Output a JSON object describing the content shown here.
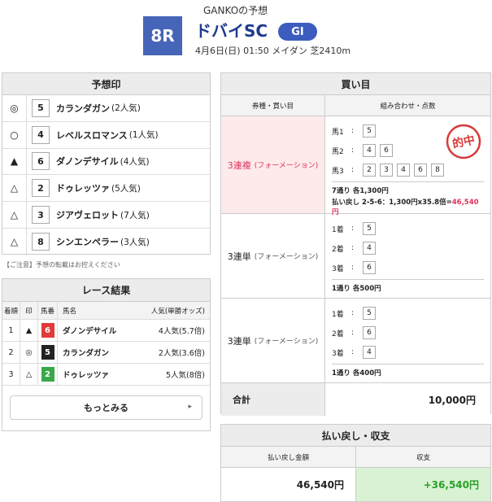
{
  "header": {
    "sub_title": "GANKOの予想",
    "race_no": "8R",
    "race_name": "ドバイSC",
    "grade": "GI",
    "race_info": "4月6日(日) 01:50 メイダン 芝2410m"
  },
  "prediction": {
    "title": "予想印",
    "rows": [
      {
        "mark": "◎",
        "num": "5",
        "name": "カランダガン",
        "pop": "(2人気)"
      },
      {
        "mark": "○",
        "num": "4",
        "name": "レベルスロマンス",
        "pop": "(1人気)"
      },
      {
        "mark": "▲",
        "num": "6",
        "name": "ダノンデサイル",
        "pop": "(4人気)"
      },
      {
        "mark": "△",
        "num": "2",
        "name": "ドゥレッツァ",
        "pop": "(5人気)"
      },
      {
        "mark": "△",
        "num": "3",
        "name": "ジアヴェロット",
        "pop": "(7人気)"
      },
      {
        "mark": "△",
        "num": "8",
        "name": "シンエンペラー",
        "pop": "(3人気)"
      }
    ],
    "notice": "【ご注意】予想の転載はお控えください"
  },
  "result": {
    "title": "レース結果",
    "headers": {
      "rank": "着順",
      "mark": "印",
      "num": "馬番",
      "name": "馬名",
      "pop": "人気(単勝オッズ)"
    },
    "rows": [
      {
        "rank": "1",
        "mark": "▲",
        "num": "6",
        "waku_color": "#e03a3a",
        "name": "ダノンデサイル",
        "pop": "4人気(5.7倍)"
      },
      {
        "rank": "2",
        "mark": "◎",
        "num": "5",
        "waku_color": "#222222",
        "name": "カランダガン",
        "pop": "2人気(3.6倍)"
      },
      {
        "rank": "3",
        "mark": "△",
        "num": "2",
        "waku_color": "#3aa84a",
        "name": "ドゥレッツァ",
        "pop": "5人気(8倍)"
      }
    ],
    "more_label": "もっとみる"
  },
  "bets": {
    "title": "買い目",
    "col_type": "券種・買い目",
    "col_combo": "組み合わせ・点数",
    "stamp_text": "的中",
    "rows": [
      {
        "type": "3連複",
        "kind": "(フォーメーション)",
        "legs": [
          {
            "label": "馬1",
            "nums": [
              "5"
            ]
          },
          {
            "label": "馬2",
            "nums": [
              "4",
              "6"
            ]
          },
          {
            "label": "馬3",
            "nums": [
              "2",
              "3",
              "4",
              "6",
              "8"
            ]
          }
        ],
        "summary": "7通り 各1,300円",
        "payout_prefix": "払い戻し 2-5-6：1,300円x35.8倍=",
        "payout_value": "46,540円"
      },
      {
        "type": "3連単",
        "kind": "(フォーメーション)",
        "legs": [
          {
            "label": "1着",
            "nums": [
              "5"
            ]
          },
          {
            "label": "2着",
            "nums": [
              "4"
            ]
          },
          {
            "label": "3着",
            "nums": [
              "6"
            ]
          }
        ],
        "summary": "1通り 各500円"
      },
      {
        "type": "3連単",
        "kind": "(フォーメーション)",
        "legs": [
          {
            "label": "1着",
            "nums": [
              "5"
            ]
          },
          {
            "label": "2着",
            "nums": [
              "6"
            ]
          },
          {
            "label": "3着",
            "nums": [
              "4"
            ]
          }
        ],
        "summary": "1通り 各400円"
      }
    ],
    "total_label": "合計",
    "total_value": "10,000円"
  },
  "payout": {
    "title": "払い戻し・収支",
    "col_amount": "払い戻し金額",
    "col_profit": "収支",
    "amount": "46,540円",
    "profit": "+36,540円"
  }
}
